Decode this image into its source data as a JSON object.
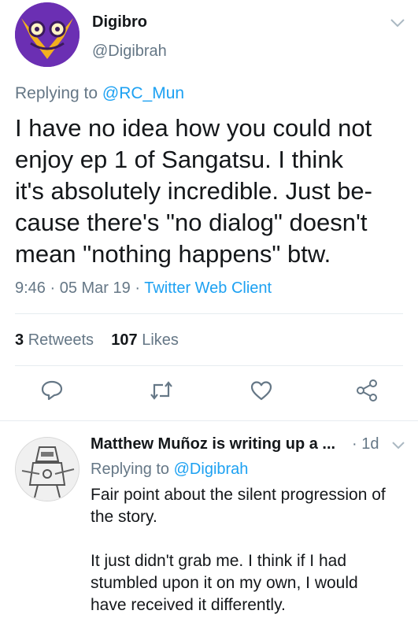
{
  "tweet": {
    "author_name": "Digibro",
    "author_handle": "@Digibrah",
    "replying_prefix": "Replying to ",
    "replying_to": "@RC_Mun",
    "text": "I have no idea how you could not\nenjoy ep 1 of Sangatsu. I think\nit's absolutely incredible. Just be-\ncause there's \"no dialog\" doesn't\nmean \"nothing happens\" btw.",
    "time": "9:46",
    "date": "05 Mar 19",
    "separator": " · ",
    "source": "Twitter Web Client",
    "retweets_count": "3",
    "retweets_label": "Retweets",
    "likes_count": "107",
    "likes_label": "Likes"
  },
  "actions": [
    {
      "name": "reply",
      "icon": "reply-icon"
    },
    {
      "name": "retweet",
      "icon": "retweet-icon"
    },
    {
      "name": "like",
      "icon": "heart-icon"
    },
    {
      "name": "share",
      "icon": "share-icon"
    }
  ],
  "reply": {
    "author_name": "Matthew Muñoz is writing up a ...",
    "time_separator": "·",
    "time": "1d",
    "replying_prefix": "Replying to ",
    "replying_to": "@Digibrah",
    "text": "Fair point about the silent progression of\nthe story.\n\nIt just didn't grab me. I think if I had\nstumbled upon it on my own, I would\nhave received it differently."
  },
  "colors": {
    "link": "#1da1f2",
    "muted": "#657786",
    "text": "#14171a",
    "divider": "#e6ecf0"
  }
}
